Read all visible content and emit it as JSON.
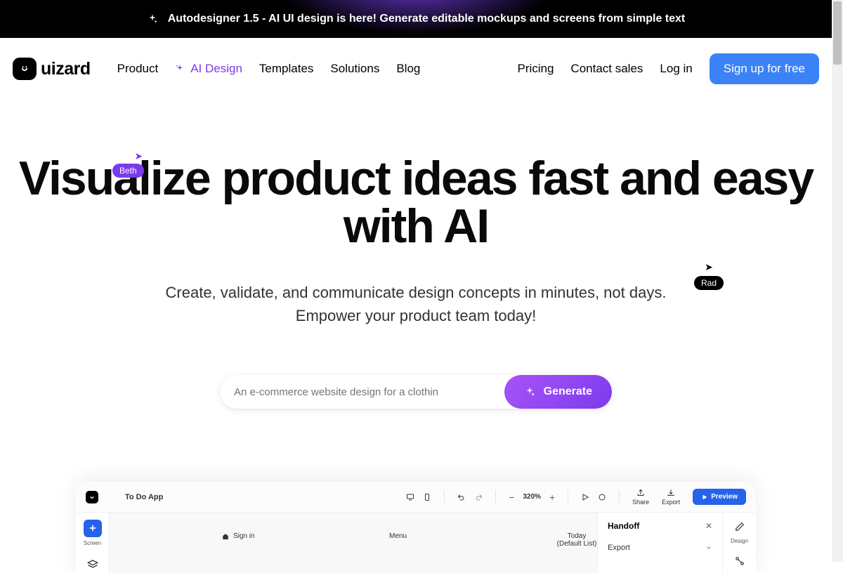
{
  "announcement": {
    "text": "Autodesigner 1.5 - AI UI design is here! Generate editable mockups and screens from simple text"
  },
  "logo": {
    "text": "uizard"
  },
  "nav": {
    "product": "Product",
    "ai_design": "AI Design",
    "templates": "Templates",
    "solutions": "Solutions",
    "blog": "Blog",
    "pricing": "Pricing",
    "contact": "Contact sales",
    "login": "Log in",
    "signup": "Sign up for free"
  },
  "hero": {
    "title": "Visualize product ideas fast and easy with AI",
    "subtitle_line1": "Create, validate, and communicate design concepts in minutes, not days.",
    "subtitle_line2": "Empower your product team today!"
  },
  "cursors": {
    "beth": "Beth",
    "rad": "Rad"
  },
  "generate": {
    "placeholder": "An e-commerce website design for a clothin",
    "button": "Generate"
  },
  "preview": {
    "app_title": "To Do App",
    "zoom": "320%",
    "share": "Share",
    "export": "Export",
    "preview_btn": "Preview",
    "sidebar": {
      "screen": "Screen"
    },
    "canvas": {
      "signin": "Sign in",
      "menu": "Menu",
      "today": "Today (Default List)"
    },
    "handoff": {
      "title": "Handoff",
      "export_label": "Export"
    },
    "right_tools": {
      "design": "Design"
    }
  }
}
